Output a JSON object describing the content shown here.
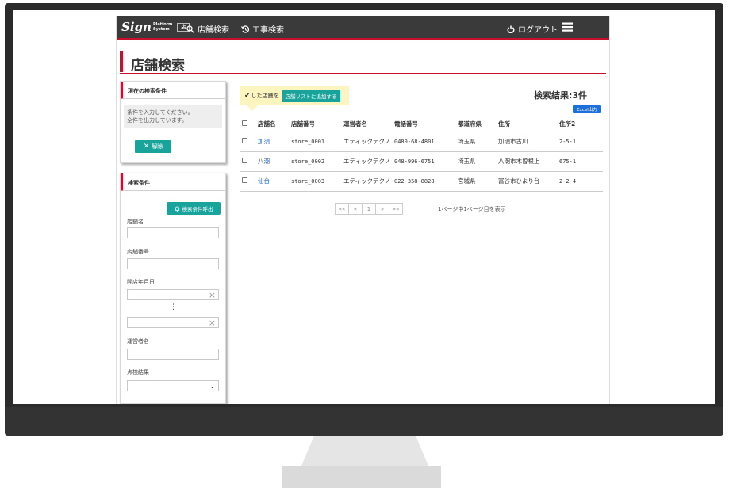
{
  "nav": {
    "logo_main": "Sign",
    "logo_sub1": "Platform",
    "logo_sub2": "System",
    "logo_box": "店",
    "store_search": "店舗検索",
    "work_search": "工事検索",
    "logout": "ログアウト"
  },
  "page": {
    "title": "店舗検索"
  },
  "current_conditions": {
    "header": "現在の検索条件",
    "message_line1": "条件を入力してください。",
    "message_line2": "全件を出力しています。",
    "clear_label": "解除"
  },
  "search_conditions": {
    "header": "検索条件",
    "recall_label": "検索条件呼出",
    "fields": {
      "store_name": "店舗名",
      "store_number": "店舗番号",
      "open_date": "開店年月日",
      "operator": "運営者名",
      "inspection": "点検結果"
    }
  },
  "hint": {
    "text": "した店舗を",
    "add_button": "店舗リストに追加する"
  },
  "results": {
    "count_label": "検索結果:3件",
    "excel_label": "Excel出力",
    "columns": [
      "店舗名",
      "店舗番号",
      "運営者名",
      "電話番号",
      "都道府県",
      "住所",
      "住所2"
    ],
    "rows": [
      {
        "name": "加須",
        "number": "store_0001",
        "operator": "エティックテクノ",
        "phone": "0480-68-4801",
        "pref": "埼玉県",
        "address": "加須市古川",
        "address2": "2-5-1"
      },
      {
        "name": "八潮",
        "number": "store_0002",
        "operator": "エティックテクノ",
        "phone": "048-996-6751",
        "pref": "埼玉県",
        "address": "八潮市木曽根上",
        "address2": "675-1"
      },
      {
        "name": "仙台",
        "number": "store_0003",
        "operator": "エティックテクノ",
        "phone": "022-358-8828",
        "pref": "宮城県",
        "address": "富谷市ひより台",
        "address2": "2-2-4"
      }
    ]
  },
  "pagination": {
    "first": "««",
    "prev": "«",
    "current": "1",
    "next": "»",
    "last": "»»",
    "info": "1ページ中1ページ目を表示"
  },
  "colors": {
    "accent": "#c8102e",
    "teal": "#1aa39a",
    "excel": "#1d6fdc",
    "nav_bg": "#3a3a3a"
  }
}
